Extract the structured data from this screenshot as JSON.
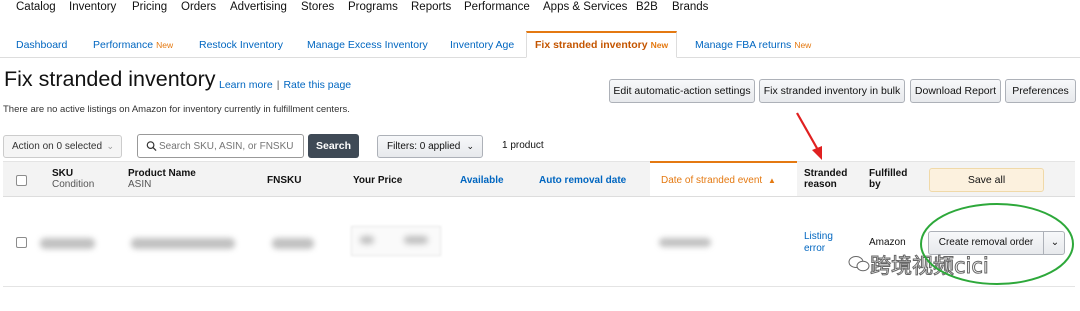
{
  "top_nav": [
    "Catalog",
    "Inventory",
    "Pricing",
    "Orders",
    "Advertising",
    "Stores",
    "Programs",
    "Reports",
    "Performance",
    "Apps & Services",
    "B2B",
    "Brands"
  ],
  "tabs": [
    {
      "label": "Dashboard",
      "badge": ""
    },
    {
      "label": "Performance",
      "badge": "New"
    },
    {
      "label": "Restock Inventory",
      "badge": ""
    },
    {
      "label": "Manage Excess Inventory",
      "badge": ""
    },
    {
      "label": "Inventory Age",
      "badge": ""
    },
    {
      "label": "Fix stranded inventory",
      "badge": "New",
      "active": true
    },
    {
      "label": "Manage FBA returns",
      "badge": "New"
    }
  ],
  "page": {
    "title": "Fix stranded inventory",
    "learn_more": "Learn more",
    "separator": "|",
    "rate_page": "Rate this page",
    "subtitle": "There are no active listings on Amazon for inventory currently in fulfillment centers."
  },
  "actions": {
    "edit_settings": "Edit automatic-action settings",
    "fix_bulk": "Fix stranded inventory in bulk",
    "download": "Download Report",
    "preferences": "Preferences"
  },
  "filters": {
    "action_select": "Action on 0 selected",
    "search_placeholder": "Search SKU, ASIN, or FNSKU",
    "search_button": "Search",
    "filters_label": "Filters: 0 applied",
    "product_count": "1 product"
  },
  "table": {
    "headers": {
      "sku": "SKU",
      "condition": "Condition",
      "product_name": "Product Name",
      "asin": "ASIN",
      "fnsku": "FNSKU",
      "your_price": "Your Price",
      "available": "Available",
      "auto_removal": "Auto removal date",
      "date_stranded": "Date of stranded event",
      "stranded_reason": "Stranded reason",
      "fulfilled_by": "Fulfilled by",
      "save_all": "Save all"
    },
    "row": {
      "stranded_reason": "Listing error",
      "fulfilled_by": "Amazon",
      "action": "Create removal order"
    }
  },
  "watermark": "跨境视频cici",
  "colors": {
    "accent": "#e47911",
    "link": "#0066c0",
    "annotation_red": "#e02020",
    "annotation_green": "#2da83a"
  }
}
